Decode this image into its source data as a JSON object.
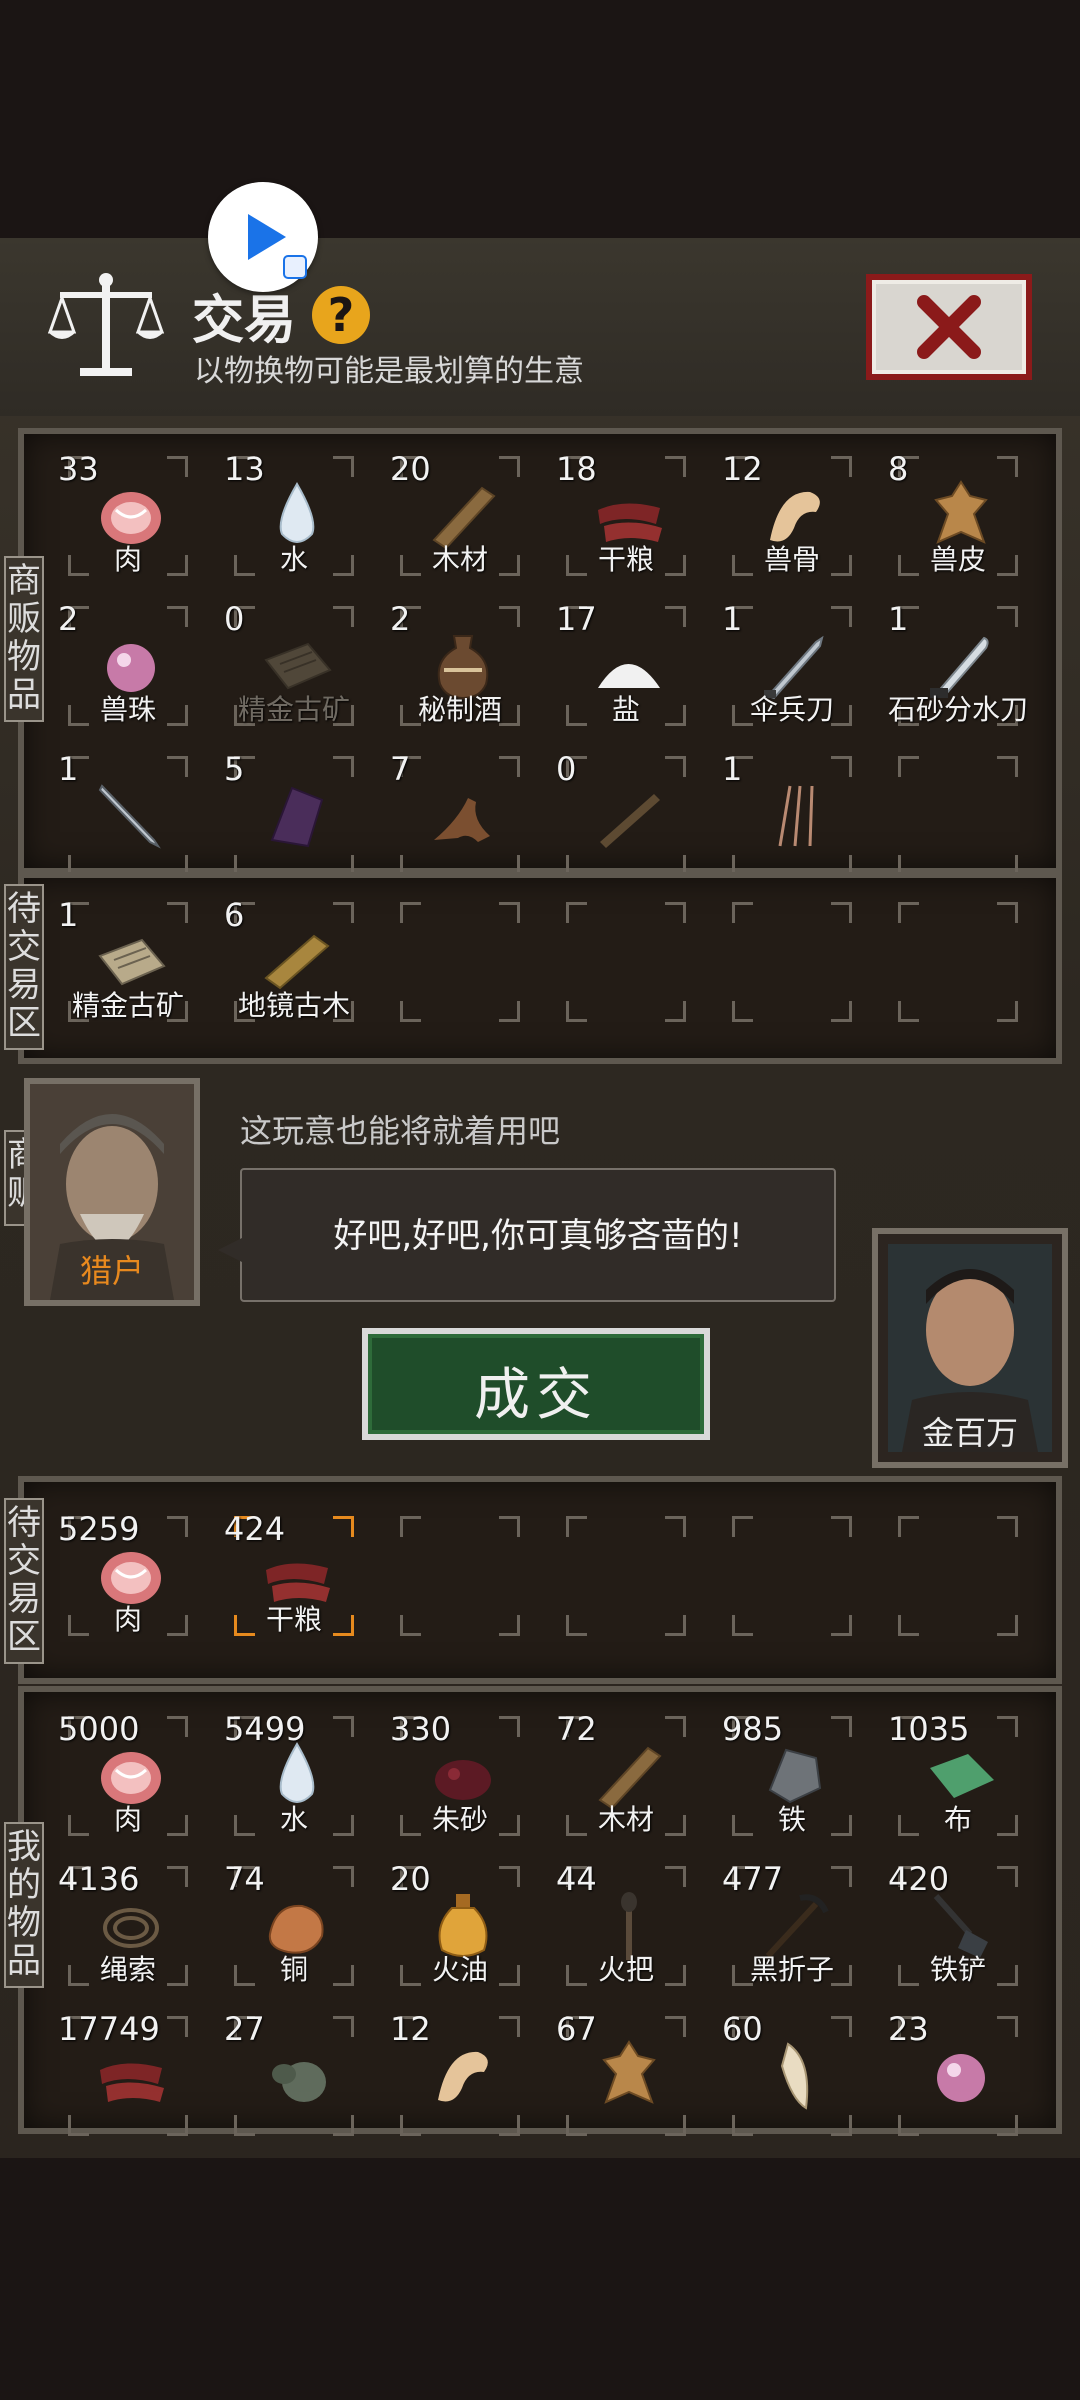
{
  "header": {
    "title": "交易",
    "help_symbol": "?",
    "subtitle": "以物换物可能是最划算的生意"
  },
  "side_labels": {
    "merchant_goods": "商贩物品",
    "merchant_pending": "待交易区",
    "merchant": "商贩",
    "my_pending": "待交易区",
    "my_goods": "我的物品"
  },
  "merchant_goods": [
    {
      "count": "33",
      "name": "肉",
      "icon": "meat-icon"
    },
    {
      "count": "13",
      "name": "水",
      "icon": "water-drop-icon"
    },
    {
      "count": "20",
      "name": "木材",
      "icon": "wood-plank-icon"
    },
    {
      "count": "18",
      "name": "干粮",
      "icon": "jerky-icon"
    },
    {
      "count": "12",
      "name": "兽骨",
      "icon": "beast-bone-icon"
    },
    {
      "count": "8",
      "name": "兽皮",
      "icon": "beast-hide-icon"
    },
    {
      "count": "2",
      "name": "兽珠",
      "icon": "pearl-icon"
    },
    {
      "count": "0",
      "name": "精金古矿",
      "icon": "gold-ore-icon",
      "dim": true
    },
    {
      "count": "2",
      "name": "秘制酒",
      "icon": "wine-jar-icon"
    },
    {
      "count": "17",
      "name": "盐",
      "icon": "salt-icon"
    },
    {
      "count": "1",
      "name": "伞兵刀",
      "icon": "knife-icon"
    },
    {
      "count": "1",
      "name": "石砂分水刀",
      "icon": "blade-icon"
    },
    {
      "count": "1",
      "name": "",
      "icon": "dagger-icon"
    },
    {
      "count": "5",
      "name": "",
      "icon": "purple-crystal-icon"
    },
    {
      "count": "7",
      "name": "",
      "icon": "root-icon"
    },
    {
      "count": "0",
      "name": "",
      "icon": "stick-icon"
    },
    {
      "count": "1",
      "name": "",
      "icon": "needles-icon"
    }
  ],
  "merchant_pending": [
    {
      "count": "1",
      "name": "精金古矿",
      "icon": "gold-ore-icon"
    },
    {
      "count": "6",
      "name": "地镜古木",
      "icon": "ancient-wood-icon"
    }
  ],
  "dialog": {
    "merchant_name": "猎户",
    "npc_line": "这玩意也能将就着用吧",
    "speech": "好吧,好吧,你可真够吝啬的!",
    "deal_label": "成交",
    "player_name": "金百万"
  },
  "my_pending": [
    {
      "count": "5259",
      "name": "肉",
      "icon": "meat-icon"
    },
    {
      "count": "424",
      "name": "干粮",
      "icon": "jerky-icon",
      "selected": true
    }
  ],
  "my_goods": [
    {
      "count": "5000",
      "name": "肉",
      "icon": "meat-icon"
    },
    {
      "count": "5499",
      "name": "水",
      "icon": "water-drop-icon"
    },
    {
      "count": "330",
      "name": "朱砂",
      "icon": "cinnabar-icon"
    },
    {
      "count": "72",
      "name": "木材",
      "icon": "wood-plank-icon"
    },
    {
      "count": "985",
      "name": "铁",
      "icon": "iron-icon"
    },
    {
      "count": "1035",
      "name": "布",
      "icon": "cloth-icon"
    },
    {
      "count": "4136",
      "name": "绳索",
      "icon": "rope-icon"
    },
    {
      "count": "74",
      "name": "铜",
      "icon": "copper-icon"
    },
    {
      "count": "20",
      "name": "火油",
      "icon": "oil-flask-icon"
    },
    {
      "count": "44",
      "name": "火把",
      "icon": "torch-icon"
    },
    {
      "count": "477",
      "name": "黑折子",
      "icon": "pickaxe-icon"
    },
    {
      "count": "420",
      "name": "铁铲",
      "icon": "shovel-icon"
    },
    {
      "count": "17749",
      "name": "",
      "icon": "jerky-icon"
    },
    {
      "count": "27",
      "name": "",
      "icon": "gourd-icon"
    },
    {
      "count": "12",
      "name": "",
      "icon": "beast-bone-icon"
    },
    {
      "count": "67",
      "name": "",
      "icon": "beast-hide-icon"
    },
    {
      "count": "60",
      "name": "",
      "icon": "fang-icon"
    },
    {
      "count": "23",
      "name": "",
      "icon": "pearl-icon"
    }
  ]
}
